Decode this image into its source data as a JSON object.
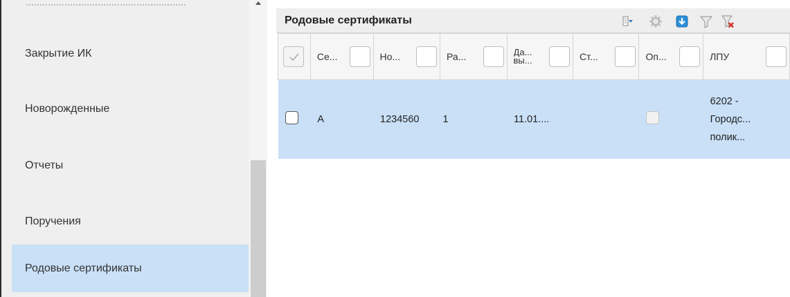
{
  "sidebar": {
    "items": [
      {
        "label": "Закрытие ИК"
      },
      {
        "label": "Новорожденные"
      },
      {
        "label": "Отчеты"
      },
      {
        "label": "Поручения"
      },
      {
        "label": "Родовые сертификаты",
        "active": true
      }
    ]
  },
  "panel": {
    "title": "Родовые сертификаты",
    "toolbar": [
      "columns-menu-icon",
      "settings-gear-icon",
      "download-icon",
      "filter-icon",
      "clear-filter-icon"
    ]
  },
  "grid": {
    "columns": [
      "Се...",
      "Но...",
      "Ра...",
      "Да... вы...",
      "Ст...",
      "Оп...",
      "ЛПУ"
    ],
    "column_header_lines": {
      "date": [
        "Да...",
        "вы..."
      ]
    },
    "rows": [
      {
        "series": "А",
        "number": "1234560",
        "ra": "1",
        "date": "11.01....",
        "status": "",
        "op_checked": false,
        "lpu": [
          "6202 -",
          "Городс...",
          "полик..."
        ]
      }
    ]
  },
  "colors": {
    "selected_row": "#c9e0f7",
    "sidebar_bg": "#efefef",
    "header_bg": "#eeeeee",
    "download_icon": "#2b8fd8",
    "clear_filter_x": "#d0342c"
  }
}
